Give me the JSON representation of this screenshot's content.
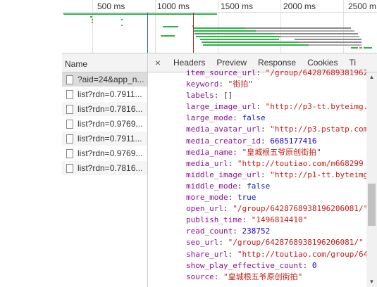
{
  "timeline": {
    "ticks": [
      "500 ms",
      "1000 ms",
      "1500 ms",
      "2000 ms",
      "2500 m"
    ]
  },
  "list": {
    "header": "Name",
    "requests": [
      {
        "name": "?aid=24&app_n..."
      },
      {
        "name": "list?rdn=0.7911..."
      },
      {
        "name": "list?rdn=0.7816..."
      },
      {
        "name": "list?rdn=0.9769..."
      },
      {
        "name": "list?rdn=0.7911..."
      },
      {
        "name": "list?rdn=0.9769..."
      },
      {
        "name": "list?rdn=0.7816..."
      }
    ]
  },
  "detail": {
    "close_glyph": "×",
    "tabs": [
      "Headers",
      "Preview",
      "Response",
      "Cookies",
      "Ti"
    ],
    "lines": [
      {
        "key": "item_source_url",
        "value": "\"/group/64287689381962",
        "type": "str"
      },
      {
        "key": "keyword",
        "value": "\"街拍\"",
        "type": "str"
      },
      {
        "key": "labels",
        "value": "[]",
        "type": "plain"
      },
      {
        "key": "large_image_url",
        "value": "\"http://p3-tt.byteimg.",
        "type": "str"
      },
      {
        "key": "large_mode",
        "value": "false",
        "type": "bool"
      },
      {
        "key": "media_avatar_url",
        "value": "\"http://p3.pstatp.com",
        "type": "str"
      },
      {
        "key": "media_creator_id",
        "value": "6685177416",
        "type": "num"
      },
      {
        "key": "media_name",
        "value": "\"皇城根五爷原创街拍\"",
        "type": "str"
      },
      {
        "key": "media_url",
        "value": "\"http://toutiao.com/m668299",
        "type": "str"
      },
      {
        "key": "middle_image_url",
        "value": "\"http://p1-tt.byteimg",
        "type": "str"
      },
      {
        "key": "middle_mode",
        "value": "false",
        "type": "bool"
      },
      {
        "key": "more_mode",
        "value": "true",
        "type": "bool"
      },
      {
        "key": "open_url",
        "value": "\"/group/6428768938196206081/\"",
        "type": "str"
      },
      {
        "key": "publish_time",
        "value": "\"1496814410\"",
        "type": "str"
      },
      {
        "key": "read_count",
        "value": "238752",
        "type": "num"
      },
      {
        "key": "seo_url",
        "value": "\"/group/6428768938196206081/\"",
        "type": "str"
      },
      {
        "key": "share_url",
        "value": "\"http://toutiao.com/group/64",
        "type": "str"
      },
      {
        "key": "show_play_effective_count",
        "value": "0",
        "type": "num"
      },
      {
        "key": "source",
        "value": "\"皇城根五爷原创街拍\"",
        "type": "str"
      }
    ]
  },
  "colors": {
    "dom_content_loaded": "#2c58c6",
    "load": "#b02a2a",
    "green_bar": "#2fb24a",
    "gray_bar": "#8a8a8a",
    "key": "#881391",
    "string": "#c41a16"
  }
}
